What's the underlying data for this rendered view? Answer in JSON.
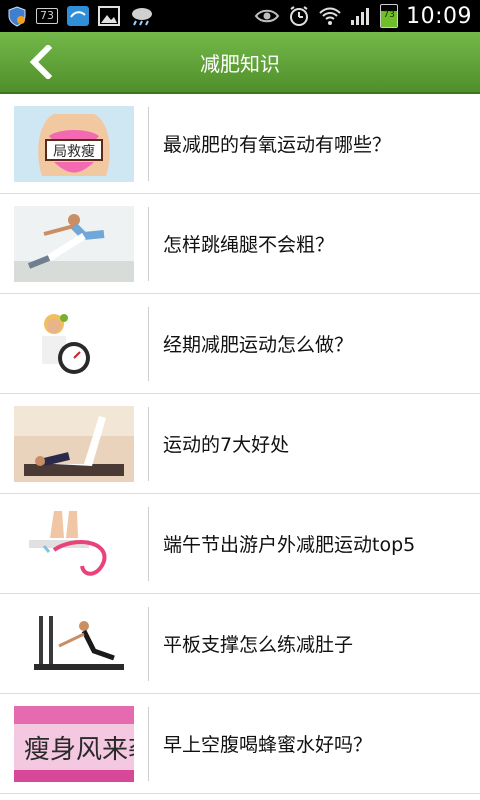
{
  "status_bar": {
    "badge_number": "73",
    "battery_level": "73",
    "time": "10:09",
    "icons": [
      "shield-icon",
      "badge-icon",
      "messaging-icon",
      "image-icon",
      "weather-icon",
      "eye-icon",
      "alarm-icon",
      "wifi-icon",
      "signal-icon",
      "battery-icon"
    ]
  },
  "header": {
    "title": "减肥知识",
    "back_icon": "chevron-left-icon"
  },
  "list": {
    "items": [
      {
        "label": "最减肥的有氧运动有哪些？",
        "thumb_text": "局救瘦"
      },
      {
        "label": "怎样跳绳腿不会粗？"
      },
      {
        "label": "经期减肥运动怎么做？"
      },
      {
        "label": "运动的7大好处"
      },
      {
        "label": "端午节出游户外减肥运动top5"
      },
      {
        "label": "平板支撑怎么练减肚子"
      },
      {
        "label": "早上空腹喝蜂蜜水好吗？",
        "thumb_text": "瘦身风来袭"
      }
    ]
  },
  "colors": {
    "header_green": "#5fa33a",
    "status_black": "#000000",
    "divider": "#dcdcdc"
  }
}
